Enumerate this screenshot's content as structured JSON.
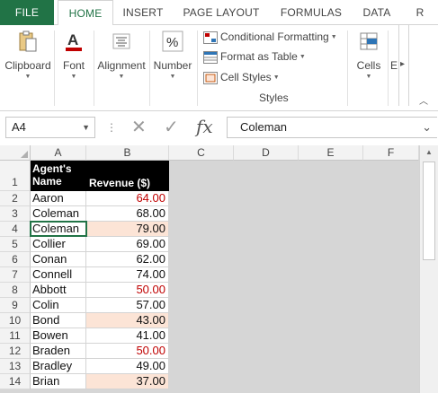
{
  "ribbon": {
    "tabs": [
      "FILE",
      "HOME",
      "INSERT",
      "PAGE LAYOUT",
      "FORMULAS",
      "DATA",
      "R"
    ],
    "active_tab": "HOME",
    "groups": {
      "clipboard": "Clipboard",
      "font": "Font",
      "alignment": "Alignment",
      "number": "Number",
      "cells": "Cells",
      "editing": "E"
    },
    "styles": {
      "conditional_formatting": "Conditional Formatting",
      "format_as_table": "Format as Table",
      "cell_styles": "Cell Styles",
      "group_label": "Styles"
    }
  },
  "formula_bar": {
    "name_box": "A4",
    "fx_label": "fx",
    "content": "Coleman"
  },
  "grid": {
    "columns": [
      "A",
      "B",
      "C",
      "D",
      "E",
      "F"
    ],
    "header": {
      "name": "Agent's Name",
      "name_line1": "Agent's",
      "name_line2": "Name",
      "revenue": "Revenue ($)"
    },
    "rows": [
      {
        "row": "1"
      },
      {
        "row": "2",
        "name": "Aaron",
        "revenue": "64.00",
        "highlight": false,
        "red": true
      },
      {
        "row": "3",
        "name": "Coleman",
        "revenue": "68.00",
        "highlight": false,
        "red": false
      },
      {
        "row": "4",
        "name": "Coleman",
        "revenue": "79.00",
        "highlight": true,
        "red": false
      },
      {
        "row": "5",
        "name": "Collier",
        "revenue": "69.00",
        "highlight": false,
        "red": false
      },
      {
        "row": "6",
        "name": "Conan",
        "revenue": "62.00",
        "highlight": false,
        "red": false
      },
      {
        "row": "7",
        "name": "Connell",
        "revenue": "74.00",
        "highlight": false,
        "red": false
      },
      {
        "row": "8",
        "name": "Abbott",
        "revenue": "50.00",
        "highlight": false,
        "red": true
      },
      {
        "row": "9",
        "name": "Colin",
        "revenue": "57.00",
        "highlight": false,
        "red": false
      },
      {
        "row": "10",
        "name": "Bond",
        "revenue": "43.00",
        "highlight": true,
        "red": false
      },
      {
        "row": "11",
        "name": "Bowen",
        "revenue": "41.00",
        "highlight": false,
        "red": false
      },
      {
        "row": "12",
        "name": "Braden",
        "revenue": "50.00",
        "highlight": false,
        "red": true
      },
      {
        "row": "13",
        "name": "Bradley",
        "revenue": "49.00",
        "highlight": false,
        "red": false
      },
      {
        "row": "14",
        "name": "Brian",
        "revenue": "37.00",
        "highlight": true,
        "red": false
      }
    ]
  },
  "colors": {
    "accent": "#217346",
    "highlight_fill": "#fce4d6",
    "negative_text": "#c00000",
    "header_fill": "#000000"
  }
}
